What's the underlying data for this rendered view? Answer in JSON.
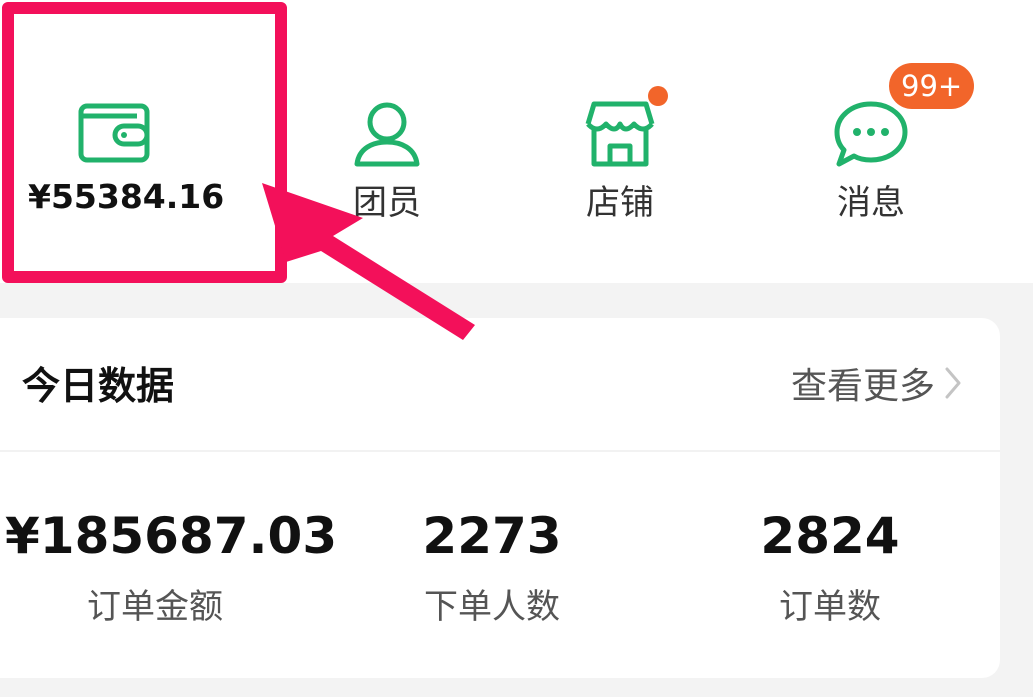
{
  "top_nav": {
    "wallet": {
      "amount": "¥55384.16",
      "icon": "wallet-icon"
    },
    "members": {
      "label": "团员",
      "icon": "person-icon"
    },
    "store": {
      "label": "店铺",
      "icon": "store-icon",
      "has_notification_dot": true
    },
    "messages": {
      "label": "消息",
      "icon": "chat-bubble-icon",
      "badge": "99+"
    }
  },
  "today_data": {
    "title": "今日数据",
    "more_link": "查看更多",
    "stats": [
      {
        "value": "¥185687.03",
        "label": "订单金额"
      },
      {
        "value": "2273",
        "label": "下单人数"
      },
      {
        "value": "2824",
        "label": "订单数"
      }
    ]
  },
  "colors": {
    "icon_green": "#21b26b",
    "badge_orange": "#f2652a",
    "highlight_pink": "#f3105a",
    "page_bg": "#f3f3f3"
  }
}
